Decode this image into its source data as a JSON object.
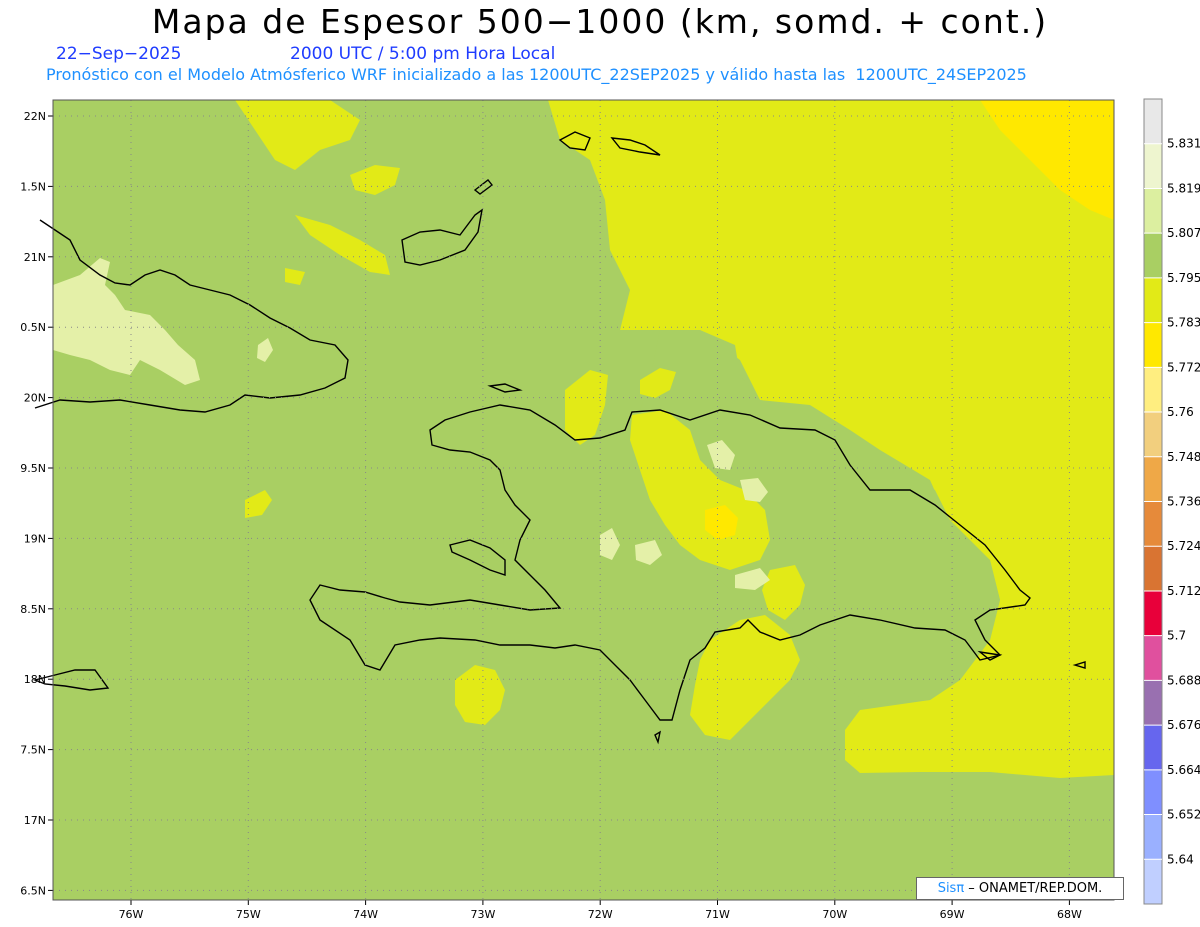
{
  "header": {
    "title": "Mapa de Espesor 500−1000 (km, somd. + cont.)",
    "date": "22−Sep−2025",
    "time": "2000 UTC / 5:00 pm Hora Local",
    "forecast": "Pronóstico con el Modelo Atmósferico WRF inicializado a las 1200UTC_22SEP2025 y válido hasta las  1200UTC_24SEP2025"
  },
  "map": {
    "lat_labels": [
      "22N",
      "1.5N",
      "21N",
      "0.5N",
      "20N",
      "9.5N",
      "19N",
      "8.5N",
      "18N",
      "7.5N",
      "17N",
      "6.5N"
    ],
    "lon_labels": [
      "76W",
      "75W",
      "74W",
      "73W",
      "72W",
      "71W",
      "70W",
      "69W",
      "68W"
    ],
    "fill_colors": {
      "base": "#a9cf63",
      "yellow": "#e2ea17",
      "gold": "#ffe800",
      "pale": "#e4f0a8",
      "orange": "#f5c842"
    },
    "coastline_color": "#000000"
  },
  "colorbar": {
    "labels": [
      "5.831",
      "5.819",
      "5.807",
      "5.795",
      "5.783",
      "5.772",
      "5.76",
      "5.748",
      "5.736",
      "5.724",
      "5.712",
      "5.7",
      "5.688",
      "5.676",
      "5.664",
      "5.652",
      "5.64"
    ],
    "colors": [
      "#e8e8e8",
      "#eef5cf",
      "#dcefa0",
      "#a9cf63",
      "#e2ea17",
      "#ffe800",
      "#ffee80",
      "#f2cf7e",
      "#efa847",
      "#e68a3a",
      "#d97432",
      "#e8003a",
      "#e0509e",
      "#9970b0",
      "#6666ee",
      "#7f8fff",
      "#9ab0ff",
      "#c0cfff"
    ]
  },
  "credit": {
    "brand": "Sisπ",
    "text": " – ONAMET/REP.DOM."
  }
}
